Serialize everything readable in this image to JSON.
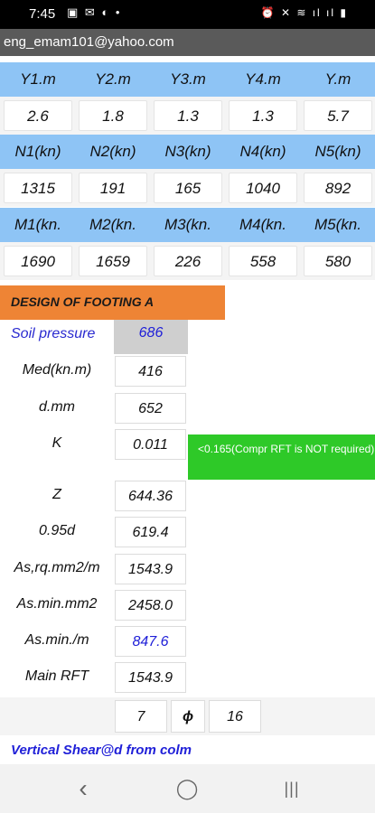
{
  "status_bar": {
    "time": "7:45",
    "left_icons_text": "▣ ✉ ◐ •",
    "right_icons_text": "⏰ ✕ ≋ ıl ıl ▮"
  },
  "header": {
    "email": "eng_emam101@yahoo.com"
  },
  "y_table": {
    "headers": [
      "Y1.m",
      "Y2.m",
      "Y3.m",
      "Y4.m",
      "Y.m"
    ],
    "values": [
      "2.6",
      "1.8",
      "1.3",
      "1.3",
      "5.7"
    ]
  },
  "n_table": {
    "headers": [
      "N1(kn)",
      "N2(kn)",
      "N3(kn)",
      "N4(kn)",
      "N5(kn)"
    ],
    "values": [
      "1315",
      "191",
      "165",
      "1040",
      "892"
    ]
  },
  "m_table": {
    "headers": [
      "M1(kn.",
      "M2(kn.",
      "M3(kn.",
      "M4(kn.",
      "M5(kn."
    ],
    "values": [
      "1690",
      "1659",
      "226",
      "558",
      "580"
    ]
  },
  "footing": {
    "title": "DESIGN OF FOOTING A",
    "soil_pressure_label": "Soil pressure",
    "soil_pressure_value": "686",
    "rows": [
      {
        "label": "Med(kn.m)",
        "value": "416"
      },
      {
        "label": "d.mm",
        "value": "652"
      },
      {
        "label": "K",
        "value": "0.011"
      },
      {
        "label": "Z",
        "value": "644.36"
      },
      {
        "label": "0.95d",
        "value": "619.4"
      },
      {
        "label": "As,rq.mm2/m",
        "value": "1543.9"
      },
      {
        "label": "As.min.mm2",
        "value": "2458.0"
      },
      {
        "label": "As.min./m",
        "value": "847.6"
      },
      {
        "label": "Main RFT",
        "value": "1543.9"
      }
    ],
    "k_note": "<0.165(Compr RFT is NOT required)",
    "rft": {
      "count": "7",
      "phi": "ϕ",
      "diameter": "16"
    },
    "shear_label": "Vertical Shear@d from colm"
  },
  "nav": {
    "back": "‹",
    "home": "◯",
    "recents": "|||"
  }
}
